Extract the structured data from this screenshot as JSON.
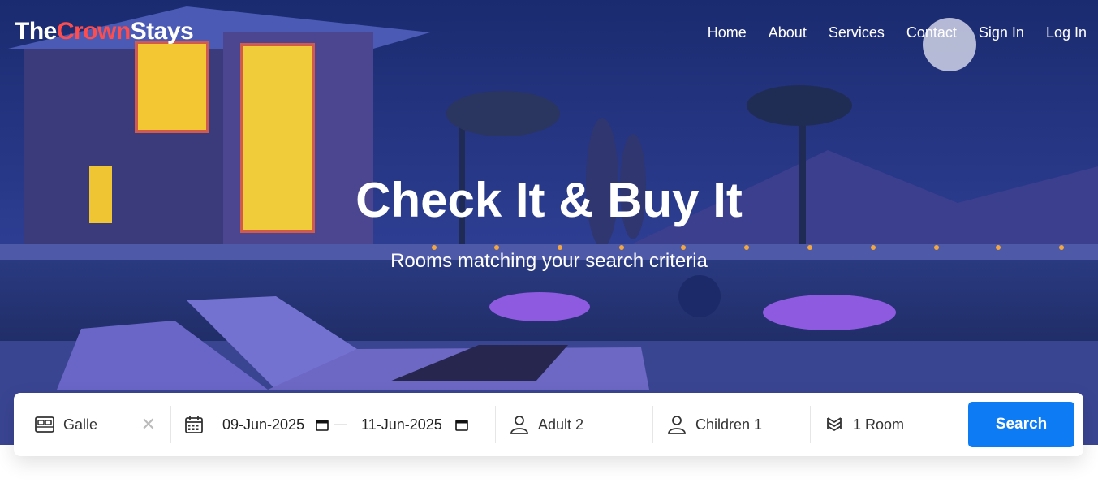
{
  "brand": {
    "part1": "The",
    "part2": "Crown",
    "part3": "Stays",
    "accent_color": "#ff4d4d"
  },
  "nav": [
    "Home",
    "About",
    "Services",
    "Contact",
    "Sign In",
    "Log In"
  ],
  "hero": {
    "title": "Check It & Buy It",
    "subtitle": "Rooms matching your search criteria"
  },
  "search": {
    "destination": "Galle",
    "checkin": "09-Jun-2025",
    "checkout": "11-Jun-2025",
    "adults": "Adult 2",
    "children": "Children 1",
    "rooms": "1 Room",
    "button": "Search",
    "button_color": "#0d7bf4"
  },
  "icons": [
    "bed-icon",
    "clear-icon",
    "calendar-icon",
    "calendar-picker-icon",
    "person-icon",
    "layers-icon"
  ]
}
